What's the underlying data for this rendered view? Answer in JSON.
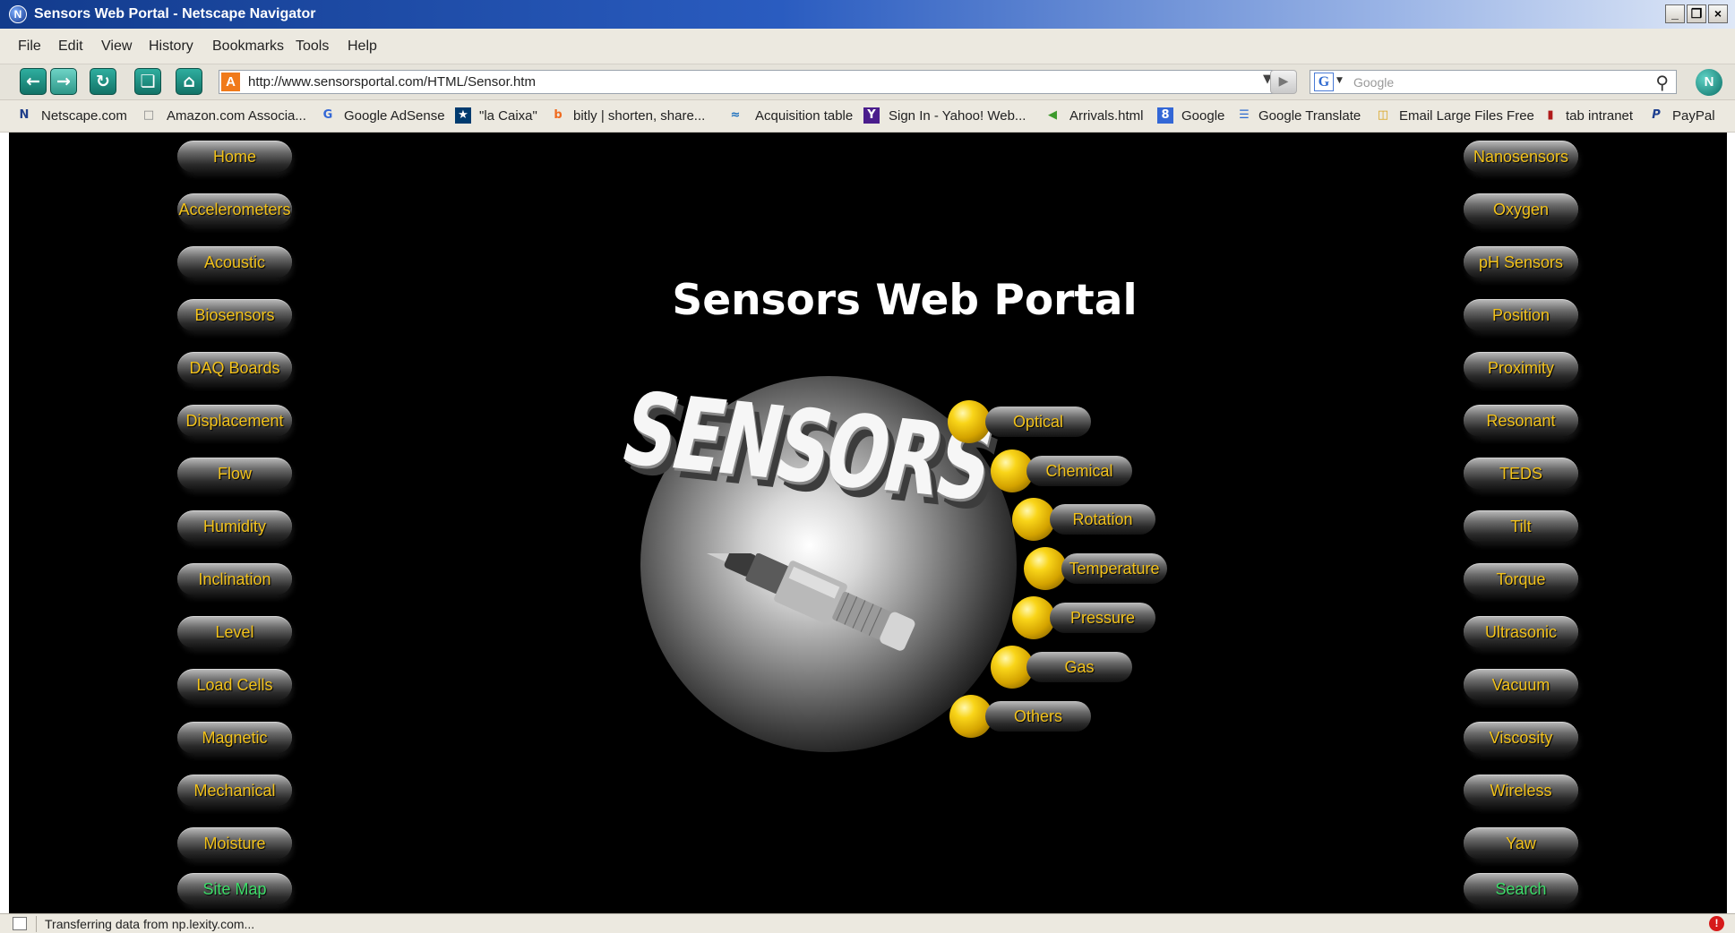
{
  "window": {
    "title": "Sensors Web Portal - Netscape Navigator",
    "controls": [
      "_",
      "❐",
      "×"
    ]
  },
  "menu": [
    "File",
    "Edit",
    "View",
    "History",
    "Bookmarks",
    "Tools",
    "Help"
  ],
  "nav": {
    "url": "http://www.sensorsportal.com/HTML/Sensor.htm",
    "search_placeholder": "Google"
  },
  "bookmarks": [
    "Netscape.com",
    "Amazon.com Associa...",
    "Google AdSense",
    "\"la Caixa\"",
    "bitly | shorten, share...",
    "Acquisition table",
    "Sign In - Yahoo! Web...",
    "Arrivals.html",
    "Google",
    "Google Translate",
    "Email Large Files Free",
    "tab intranet",
    "PayPal"
  ],
  "page": {
    "title": "Sensors Web Portal",
    "logo_text": "SENSORS",
    "left_nav": [
      "Home",
      "Accelerometers",
      "Acoustic",
      "Biosensors",
      "DAQ Boards",
      "Displacement",
      "Flow",
      "Humidity",
      "Inclination",
      "Level",
      "Load Cells",
      "Magnetic",
      "Mechanical",
      "Moisture",
      "Site Map"
    ],
    "right_nav": [
      "Nanosensors",
      "Oxygen",
      "pH Sensors",
      "Position",
      "Proximity",
      "Resonant",
      "TEDS",
      "Tilt",
      "Torque",
      "Ultrasonic",
      "Vacuum",
      "Viscosity",
      "Wireless",
      "Yaw",
      "Search"
    ],
    "categories": [
      "Optical",
      "Chemical",
      "Rotation",
      "Temperature",
      "Pressure",
      "Gas",
      "Others"
    ]
  },
  "status": {
    "text": "Transferring data from np.lexity.com..."
  },
  "colors": {
    "pill_text": "#f2c21c",
    "pill_text_active": "#3edc6a",
    "background": "#000000",
    "titlebar": "#123b8c"
  }
}
